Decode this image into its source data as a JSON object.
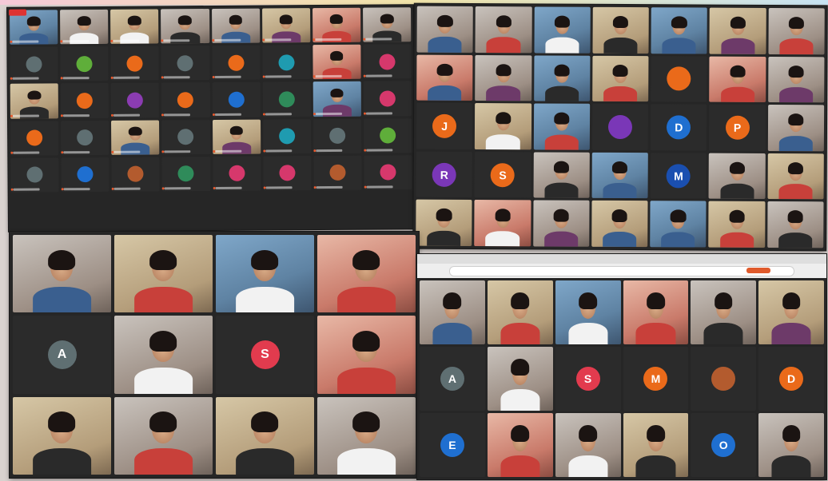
{
  "colors": {
    "avatar_palette": {
      "orange": "#ea6a1a",
      "green": "#5fae3a",
      "purple": "#8b3cb2",
      "teal": "#1f9bb0",
      "blue": "#1f6fd0",
      "pink": "#d6386c",
      "darkgreen": "#2f8b5a",
      "red": "#e23b4e",
      "gray": "#5f6f72",
      "navy": "#1a4fb0",
      "violet": "#7a37b7",
      "brown": "#b35b2e"
    }
  },
  "screens": {
    "a": {
      "tiles": [
        {
          "kind": "video",
          "shade": "alt2",
          "tone": "s1"
        },
        {
          "kind": "video",
          "shade": "alt1",
          "tone": "s3"
        },
        {
          "kind": "video",
          "shade": "alt3",
          "tone": "s3"
        },
        {
          "kind": "video",
          "shade": "alt1",
          "tone": "s5"
        },
        {
          "kind": "video",
          "shade": "alt1",
          "tone": "s1"
        },
        {
          "kind": "video",
          "shade": "alt3",
          "tone": "s4"
        },
        {
          "kind": "video",
          "shade": "alt4",
          "tone": "s2"
        },
        {
          "kind": "video",
          "shade": "alt1",
          "tone": "s5"
        },
        {
          "kind": "avatar",
          "letter": "",
          "color": "gray"
        },
        {
          "kind": "avatar",
          "letter": "",
          "color": "green"
        },
        {
          "kind": "avatar",
          "letter": "",
          "color": "orange"
        },
        {
          "kind": "avatar",
          "letter": "",
          "color": "gray"
        },
        {
          "kind": "avatar",
          "letter": "",
          "color": "orange"
        },
        {
          "kind": "avatar",
          "letter": "",
          "color": "teal"
        },
        {
          "kind": "video",
          "shade": "alt4",
          "tone": "s2"
        },
        {
          "kind": "avatar",
          "letter": "",
          "color": "pink"
        },
        {
          "kind": "video",
          "shade": "alt3",
          "tone": "s5"
        },
        {
          "kind": "avatar",
          "letter": "",
          "color": "orange"
        },
        {
          "kind": "avatar",
          "letter": "",
          "color": "purple"
        },
        {
          "kind": "avatar",
          "letter": "",
          "color": "orange"
        },
        {
          "kind": "avatar",
          "letter": "",
          "color": "blue"
        },
        {
          "kind": "avatar",
          "letter": "",
          "color": "darkgreen"
        },
        {
          "kind": "video",
          "shade": "alt2",
          "tone": "s4"
        },
        {
          "kind": "avatar",
          "letter": "",
          "color": "pink"
        },
        {
          "kind": "avatar",
          "letter": "",
          "color": "orange"
        },
        {
          "kind": "avatar",
          "letter": "",
          "color": "gray"
        },
        {
          "kind": "video",
          "shade": "alt3",
          "tone": "s1"
        },
        {
          "kind": "avatar",
          "letter": "",
          "color": "gray"
        },
        {
          "kind": "video",
          "shade": "alt3",
          "tone": "s4"
        },
        {
          "kind": "avatar",
          "letter": "",
          "color": "teal"
        },
        {
          "kind": "avatar",
          "letter": "",
          "color": "gray"
        },
        {
          "kind": "avatar",
          "letter": "",
          "color": "green"
        },
        {
          "kind": "avatar",
          "letter": "",
          "color": "gray"
        },
        {
          "kind": "avatar",
          "letter": "",
          "color": "blue"
        },
        {
          "kind": "avatar",
          "letter": "",
          "color": "brown"
        },
        {
          "kind": "avatar",
          "letter": "",
          "color": "darkgreen"
        },
        {
          "kind": "avatar",
          "letter": "",
          "color": "pink"
        },
        {
          "kind": "avatar",
          "letter": "",
          "color": "pink"
        },
        {
          "kind": "avatar",
          "letter": "",
          "color": "brown"
        },
        {
          "kind": "avatar",
          "letter": "",
          "color": "pink"
        }
      ]
    },
    "b": {
      "tiles": [
        {
          "kind": "video",
          "shade": "alt1",
          "tone": "s1"
        },
        {
          "kind": "video",
          "shade": "alt1",
          "tone": "s2"
        },
        {
          "kind": "video",
          "shade": "alt2",
          "tone": "s3"
        },
        {
          "kind": "video",
          "shade": "alt3",
          "tone": "s5"
        },
        {
          "kind": "video",
          "shade": "alt2",
          "tone": "s1"
        },
        {
          "kind": "video",
          "shade": "alt3",
          "tone": "s4"
        },
        {
          "kind": "video",
          "shade": "alt1",
          "tone": "s2"
        },
        {
          "kind": "video",
          "shade": "alt4",
          "tone": "s1"
        },
        {
          "kind": "video",
          "shade": "alt1",
          "tone": "s4"
        },
        {
          "kind": "video",
          "shade": "alt2",
          "tone": "s5"
        },
        {
          "kind": "video",
          "shade": "alt3",
          "tone": "s2"
        },
        {
          "kind": "avatar",
          "letter": "",
          "color": "orange"
        },
        {
          "kind": "video",
          "shade": "alt4",
          "tone": "s2"
        },
        {
          "kind": "video",
          "shade": "alt1",
          "tone": "s4"
        },
        {
          "kind": "avatar",
          "letter": "J",
          "color": "orange"
        },
        {
          "kind": "video",
          "shade": "alt3",
          "tone": "s3"
        },
        {
          "kind": "video",
          "shade": "alt2",
          "tone": "s2"
        },
        {
          "kind": "avatar",
          "letter": "",
          "color": "violet"
        },
        {
          "kind": "avatar",
          "letter": "D",
          "color": "blue"
        },
        {
          "kind": "avatar",
          "letter": "P",
          "color": "orange"
        },
        {
          "kind": "video",
          "shade": "alt1",
          "tone": "s1"
        },
        {
          "kind": "avatar",
          "letter": "R",
          "color": "violet"
        },
        {
          "kind": "avatar",
          "letter": "S",
          "color": "orange"
        },
        {
          "kind": "video",
          "shade": "alt1",
          "tone": "s5"
        },
        {
          "kind": "video",
          "shade": "alt2",
          "tone": "s1"
        },
        {
          "kind": "avatar",
          "letter": "M",
          "color": "navy"
        },
        {
          "kind": "video",
          "shade": "alt1",
          "tone": "s5"
        },
        {
          "kind": "video",
          "shade": "alt3",
          "tone": "s2"
        },
        {
          "kind": "video",
          "shade": "alt3",
          "tone": "s5"
        },
        {
          "kind": "video",
          "shade": "alt4",
          "tone": "s3"
        },
        {
          "kind": "video",
          "shade": "alt1",
          "tone": "s4"
        },
        {
          "kind": "video",
          "shade": "alt3",
          "tone": "s1"
        },
        {
          "kind": "video",
          "shade": "alt2",
          "tone": "s1"
        },
        {
          "kind": "video",
          "shade": "alt3",
          "tone": "s2"
        },
        {
          "kind": "video",
          "shade": "alt1",
          "tone": "s5"
        }
      ]
    },
    "c": {
      "tiles": [
        {
          "kind": "video",
          "shade": "alt1",
          "tone": "s1"
        },
        {
          "kind": "video",
          "shade": "alt3",
          "tone": "s2"
        },
        {
          "kind": "video",
          "shade": "alt2",
          "tone": "s3"
        },
        {
          "kind": "video",
          "shade": "alt4",
          "tone": "s2"
        },
        {
          "kind": "avatar",
          "letter": "A",
          "color": "gray"
        },
        {
          "kind": "video",
          "shade": "alt1",
          "tone": "s3"
        },
        {
          "kind": "avatar",
          "letter": "S",
          "color": "red"
        },
        {
          "kind": "video",
          "shade": "alt4",
          "tone": "s2"
        },
        {
          "kind": "video",
          "shade": "alt3",
          "tone": "s5"
        },
        {
          "kind": "video",
          "shade": "alt1",
          "tone": "s2"
        },
        {
          "kind": "video",
          "shade": "alt3",
          "tone": "s5"
        },
        {
          "kind": "video",
          "shade": "alt1",
          "tone": "s3"
        }
      ]
    },
    "d": {
      "tiles": [
        {
          "kind": "video",
          "shade": "alt1",
          "tone": "s1"
        },
        {
          "kind": "video",
          "shade": "alt3",
          "tone": "s2"
        },
        {
          "kind": "video",
          "shade": "alt2",
          "tone": "s3"
        },
        {
          "kind": "video",
          "shade": "alt4",
          "tone": "s2"
        },
        {
          "kind": "video",
          "shade": "alt1",
          "tone": "s5"
        },
        {
          "kind": "video",
          "shade": "alt3",
          "tone": "s4"
        },
        {
          "kind": "avatar",
          "letter": "A",
          "color": "gray"
        },
        {
          "kind": "video",
          "shade": "alt1",
          "tone": "s3"
        },
        {
          "kind": "avatar",
          "letter": "S",
          "color": "red"
        },
        {
          "kind": "avatar",
          "letter": "M",
          "color": "orange"
        },
        {
          "kind": "avatar",
          "letter": "",
          "color": "brown"
        },
        {
          "kind": "avatar",
          "letter": "D",
          "color": "orange"
        },
        {
          "kind": "avatar",
          "letter": "E",
          "color": "blue"
        },
        {
          "kind": "video",
          "shade": "alt4",
          "tone": "s2"
        },
        {
          "kind": "video",
          "shade": "alt1",
          "tone": "s3"
        },
        {
          "kind": "video",
          "shade": "alt3",
          "tone": "s5"
        },
        {
          "kind": "avatar",
          "letter": "O",
          "color": "blue"
        },
        {
          "kind": "video",
          "shade": "alt1",
          "tone": "s5"
        }
      ]
    }
  }
}
